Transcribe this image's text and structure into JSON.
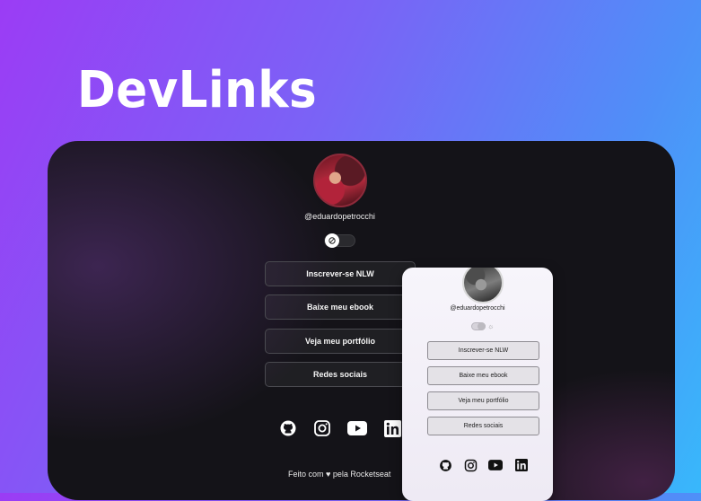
{
  "brand": {
    "title": "DevLinks"
  },
  "dark_preview": {
    "handle": "@eduardopetrocchi",
    "buttons": [
      "Inscrever-se NLW",
      "Baixe meu ebook",
      "Veja meu portfólio",
      "Redes sociais"
    ],
    "social_icons": [
      "github-icon",
      "instagram-icon",
      "youtube-icon",
      "linkedin-icon"
    ],
    "footer": "Feito com ♥ pela Rocketseat"
  },
  "light_preview": {
    "handle": "@eduardopetrocchi",
    "buttons": [
      "Inscrever-se NLW",
      "Baixe meu ebook",
      "Veja meu portfólio",
      "Redes sociais"
    ],
    "social_icons": [
      "github-icon",
      "instagram-icon",
      "youtube-icon",
      "linkedin-icon"
    ]
  },
  "colors": {
    "gradient_start": "#9b3cf5",
    "gradient_end": "#38b8fb",
    "dark_card": "#141318",
    "light_card": "#f7f5fb"
  }
}
